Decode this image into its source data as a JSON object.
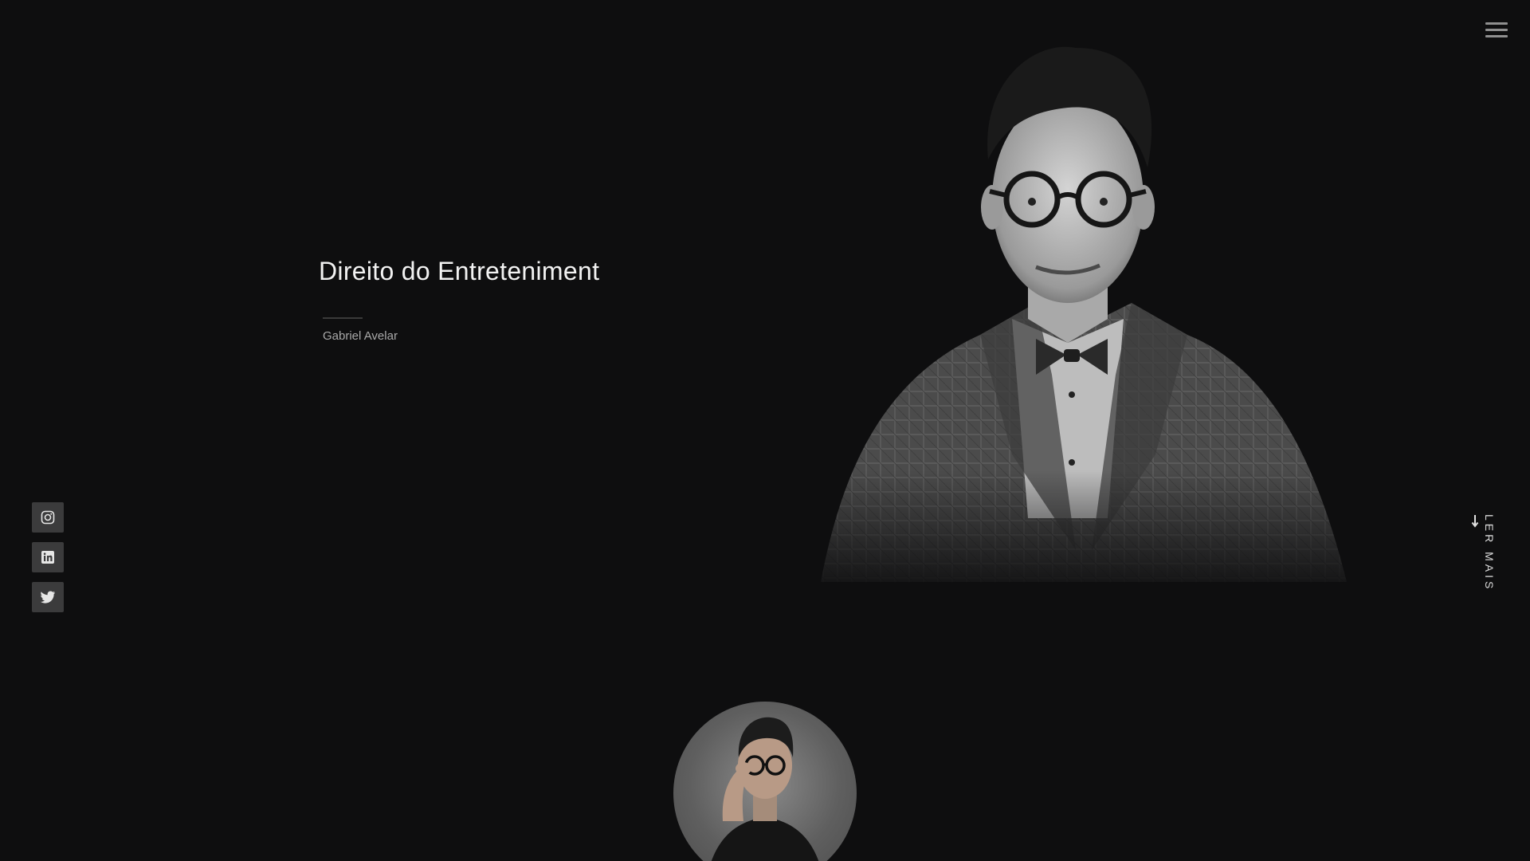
{
  "header": {
    "menu_icon": "hamburger-icon"
  },
  "hero": {
    "title": "Direito do Entreteniment",
    "author": "Gabriel Avelar"
  },
  "social": [
    {
      "icon": "instagram-icon"
    },
    {
      "icon": "linkedin-icon"
    },
    {
      "icon": "twitter-icon"
    }
  ],
  "read_more": {
    "label": "LER MAIS",
    "icon": "arrow-down-icon"
  },
  "colors": {
    "background": "#0e0e0f",
    "title": "#f2f2f2",
    "social_button": "#3b3b3c"
  }
}
